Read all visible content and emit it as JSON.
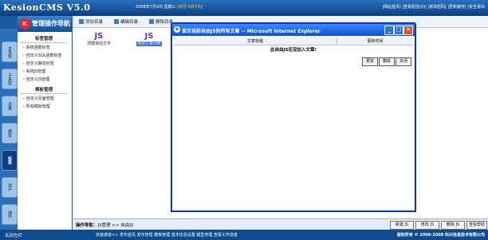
{
  "header": {
    "logo": "KesionCMS V5.0",
    "date_text": "2008年7月9日 星期三",
    "date_highlight": "[农历 6月7日]",
    "top_links": "|网站首页| |查看短信(0)| |修改密码| |更新缓存| |安全退出"
  },
  "nav": {
    "title": "管理操作导航",
    "logo_letter": "K",
    "sections": [
      {
        "title": "标签管理",
        "items": [
          "系统函数标签",
          "自定义SQL函数标签",
          "自定义静态标签",
          "系统JS管理",
          "自定义JS管理"
        ]
      },
      {
        "title": "模板管理",
        "items": [
          "自定义页面管理",
          "所有模板管理"
        ]
      }
    ]
  },
  "vtabs": [
    "主系统",
    "子系统",
    "设置",
    "模型",
    "标签",
    "用户",
    "插件"
  ],
  "active_vtab": "标签",
  "toolbar": {
    "add": "添加目录",
    "edit": "编辑目录",
    "delete": "删除目录",
    "js_label": "JS",
    "item1": "顶部滚动文字",
    "item2": "搜搜文章列表"
  },
  "main_nav": {
    "label": "操作导航：",
    "path": "JS管理 >> 自由JS",
    "buttons": [
      "新建 JS",
      "修改 JS",
      "删除 JS",
      "查看帮助"
    ]
  },
  "footer": {
    "close": "关闭左栏",
    "links": "快速通道>> 发布首页 发布管理 模板管理 基本信息设置 模型管理 查看工作进度",
    "copyright": "版权所有 © 2006-2008 科兴信息技术有限公司"
  },
  "dialog": {
    "title": "显示当前自由JS的所有文章 -- Microsoft Internet Explorer",
    "col_title": "文章标题",
    "col_time": "更新时间",
    "empty_text": "此自由JS还没加入文章!",
    "buttons": [
      "预览",
      "删除",
      "关闭"
    ],
    "minimize": "_",
    "maximize": "□",
    "close": "×"
  }
}
